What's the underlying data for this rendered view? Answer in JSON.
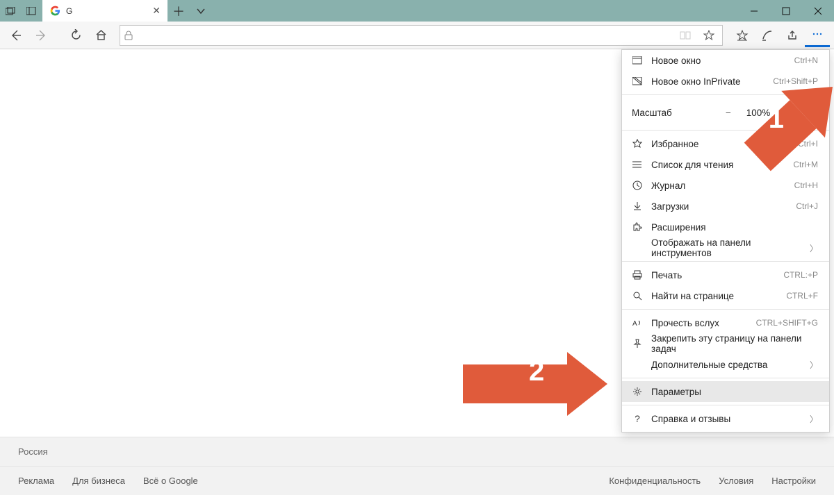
{
  "titlebar": {
    "tab_title": "G",
    "sys_minimize_tip": "Minimize",
    "sys_maximize_tip": "Maximize",
    "sys_close_tip": "Close"
  },
  "navbar": {
    "url_value": "",
    "url_placeholder": ""
  },
  "menu": {
    "new_window": {
      "label": "Новое окно",
      "shortcut": "Ctrl+N"
    },
    "new_inprivate": {
      "label": "Новое окно InPrivate",
      "shortcut": "Ctrl+Shift+P"
    },
    "zoom": {
      "label": "Масштаб",
      "value": "100%"
    },
    "favorites": {
      "label": "Избранное",
      "shortcut": "Ctrl+I"
    },
    "reading_list": {
      "label": "Список для чтения",
      "shortcut": "Ctrl+M"
    },
    "history": {
      "label": "Журнал",
      "shortcut": "Ctrl+H"
    },
    "downloads": {
      "label": "Загрузки",
      "shortcut": "Ctrl+J"
    },
    "extensions": {
      "label": "Расширения"
    },
    "show_in_toolbar": {
      "label": "Отображать на панели инструментов"
    },
    "print": {
      "label": "Печать",
      "shortcut": "CTRL:+P"
    },
    "find_on_page": {
      "label": "Найти на странице",
      "shortcut": "CTRL+F"
    },
    "read_aloud": {
      "label": "Прочесть вслух",
      "shortcut": "CTRL+SHIFT+G"
    },
    "pin_to_taskbar": {
      "label": "Закрепить эту страницу на панели задач"
    },
    "more_tools": {
      "label": "Дополнительные средства"
    },
    "settings": {
      "label": "Параметры"
    },
    "help": {
      "label": "Справка и отзывы"
    }
  },
  "footer": {
    "country": "Россия",
    "left": {
      "ads": "Реклама",
      "business": "Для бизнеса",
      "about": "Всё о Google"
    },
    "right": {
      "privacy": "Конфиденциальность",
      "terms": "Условия",
      "settings": "Настройки"
    }
  },
  "annotations": {
    "one": "1",
    "two": "2"
  },
  "colors": {
    "accent": "#E05B3B",
    "titlebar": "#89B1AD",
    "edge_highlight": "#0c6bd6"
  }
}
